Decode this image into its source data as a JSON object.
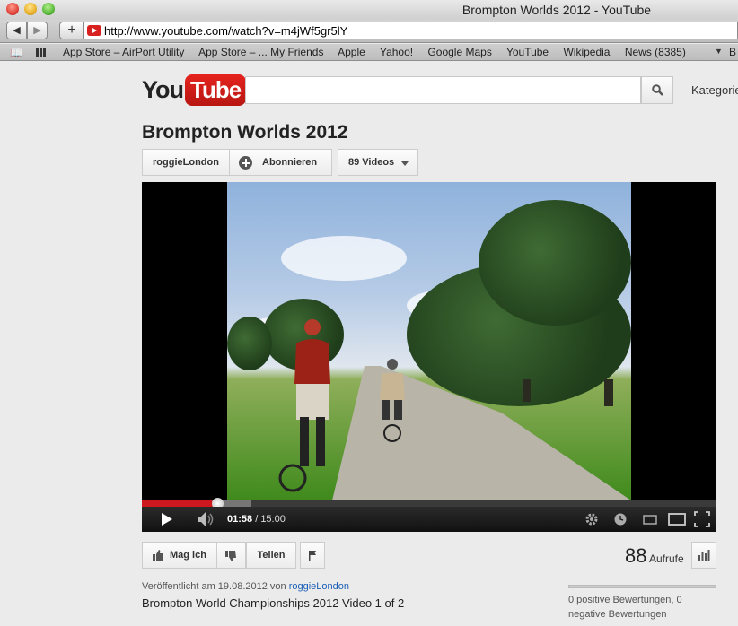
{
  "window": {
    "title": "Brompton Worlds 2012 - YouTube"
  },
  "toolbar": {
    "url": "http://www.youtube.com/watch?v=m4jWf5gr5lY"
  },
  "bookmarks": {
    "items": [
      "App Store – AirPort Utility",
      "App Store – ... My Friends",
      "Apple",
      "Yahoo!",
      "Google Maps",
      "YouTube",
      "Wikipedia",
      "News (8385)"
    ],
    "overflow": "B"
  },
  "header": {
    "logo_you": "You",
    "logo_tube": "Tube",
    "search_value": "",
    "categories_label": "Kategorien"
  },
  "video": {
    "title": "Brompton Worlds 2012",
    "channel": "roggieLondon",
    "subscribe_label": "Abonnieren",
    "videos_label": "89 Videos",
    "current_time": "01:58",
    "duration": "15:00",
    "time_separator": " / ",
    "progress_fraction": 0.131,
    "buffered_fraction": 0.19
  },
  "actions": {
    "like_label": "Mag ich",
    "share_label": "Teilen",
    "views_count": "88",
    "views_label": "Aufrufe"
  },
  "details": {
    "published_prefix": "Veröffentlicht am 19.08.2012 von",
    "published_channel": "roggieLondon",
    "description": "Brompton World Championships 2012 Video 1 of 2",
    "ratings_text": "0 positive Bewertungen, 0 negative Bewertungen"
  },
  "colors": {
    "brand_red": "#cc181e",
    "link_blue": "#1b5fb6"
  }
}
